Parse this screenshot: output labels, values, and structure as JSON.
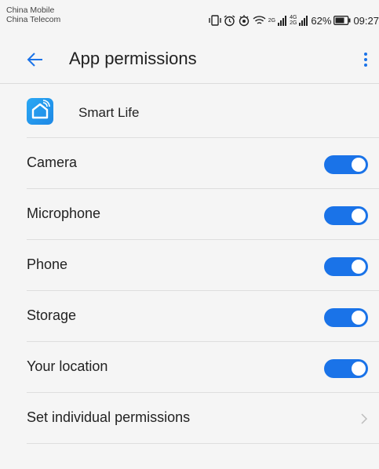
{
  "status_bar": {
    "carrier_1": "China Mobile",
    "carrier_2": "China Telecom",
    "sig1_top": "2G",
    "sig2_top": "4G",
    "sig2_bottom": "2G",
    "battery": "62%",
    "time": "09:27"
  },
  "app_bar": {
    "title": "App permissions",
    "back_icon": "arrow-left",
    "menu_icon": "more-vertical",
    "accent_color": "#1a73e8"
  },
  "app": {
    "name": "Smart Life",
    "icon": "smart-life-app-icon"
  },
  "permissions": [
    {
      "label": "Camera",
      "enabled": true
    },
    {
      "label": "Microphone",
      "enabled": true
    },
    {
      "label": "Phone",
      "enabled": true
    },
    {
      "label": "Storage",
      "enabled": true
    },
    {
      "label": "Your location",
      "enabled": true
    }
  ],
  "individual": {
    "label": "Set individual permissions",
    "chevron_icon": "chevron-right"
  }
}
